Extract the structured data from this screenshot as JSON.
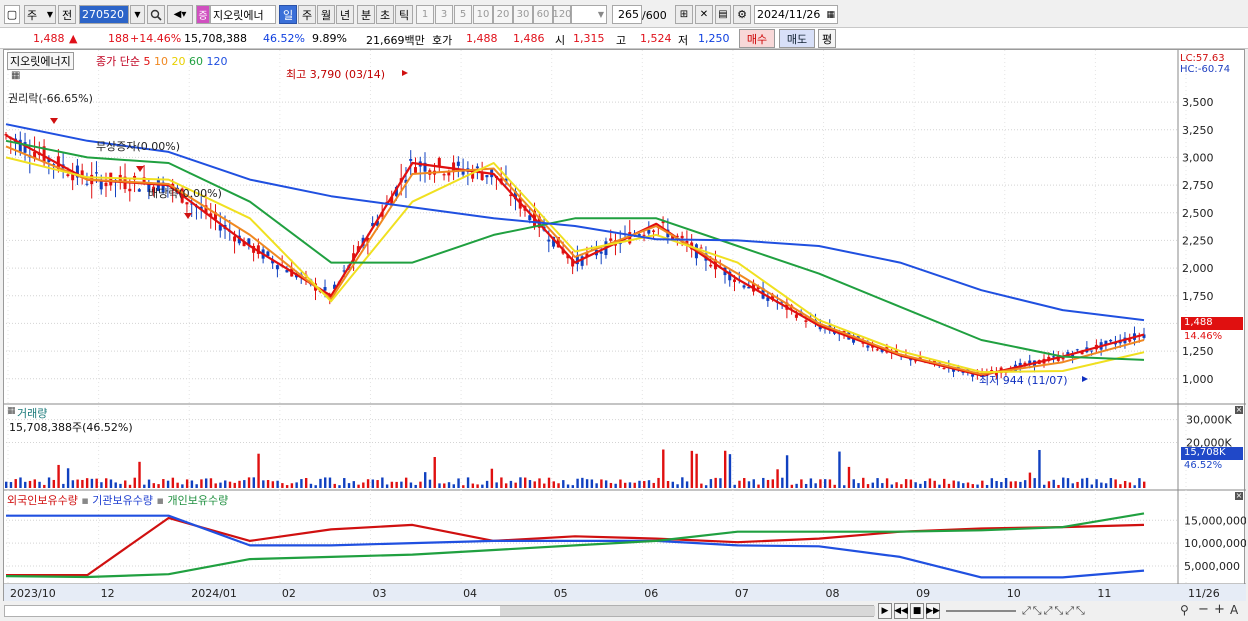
{
  "toolbar": {
    "period_type": "주",
    "prev_label": "전",
    "stock_code": "270520",
    "stock_badge": "증",
    "stock_name": "지오릿에너",
    "tabs": [
      "일",
      "주",
      "월",
      "년",
      "분",
      "초",
      "틱"
    ],
    "active_tab": "일",
    "intervals": [
      "1",
      "3",
      "5",
      "10",
      "20",
      "30",
      "60",
      "120"
    ],
    "count_value": "265",
    "count_total": "/600",
    "date": "2024/11/26"
  },
  "quote": {
    "price": "1,488",
    "change": "188",
    "change_pct": "+14.46%",
    "volume": "15,708,388",
    "vol_pct": "46.52%",
    "turnover_pct": "9.89%",
    "amount": "21,669백만",
    "hoga_label": "호가",
    "hoga_ask": "1,488",
    "hoga_bid": "1,486",
    "open_label": "시",
    "open": "1,315",
    "high_label": "고",
    "high": "1,524",
    "low_label": "저",
    "low": "1,250",
    "buy_label": "매수",
    "sell_label": "매도",
    "avg_label": "평"
  },
  "price_panel": {
    "name_box": "지오릿에너지",
    "ma_title": "종가 단순",
    "ma_periods": [
      "5",
      "10",
      "20",
      "60",
      "120"
    ],
    "lc_label": "LC:57.63",
    "hc_label": "HC:-60.74",
    "high_annotation": "최고 3,790 (03/14)",
    "low_annotation": "최저 944 (11/07)",
    "event_labels": [
      "권리락(-66.65%)",
      "무상증자(0.00%)",
      "배당락(0.00%)"
    ],
    "current_price": "1,488",
    "current_change": "14.46%"
  },
  "volume_panel": {
    "title": "거래량",
    "summary": "15,708,388주(46.52%)",
    "current_label": "15,708K",
    "current_pct": "46.52%"
  },
  "holding_panel": {
    "legend": [
      "외국인보유수량",
      "기관보유수량",
      "개인보유수량"
    ]
  },
  "x_axis_labels": [
    "2023/10",
    "12",
    "2024/01",
    "02",
    "03",
    "04",
    "05",
    "06",
    "07",
    "08",
    "09",
    "10",
    "11",
    "11/26"
  ],
  "colors": {
    "ma5": "#e01010",
    "ma10": "#f08820",
    "ma20": "#f0e020",
    "ma60": "#20a040",
    "ma120": "#2050e0",
    "up": "#e01010",
    "down": "#1040c0"
  },
  "chart_data": [
    {
      "type": "line",
      "name": "price-candles",
      "y_axis_ticks": [
        1000,
        1250,
        1500,
        1750,
        2000,
        2250,
        2500,
        2750,
        3000,
        3250,
        3500
      ],
      "y_axis_labels": [
        "1,000",
        "1,250",
        "1,500",
        "1,750",
        "2,000",
        "2,250",
        "2,500",
        "2,750",
        "3,000",
        "3,250",
        "3,500"
      ],
      "ylim": [
        790,
        3790
      ],
      "x": [
        "2023/10",
        "2023/11",
        "2023/12",
        "2024/01",
        "2024/02",
        "2024/03",
        "2024/04",
        "2024/05",
        "2024/06",
        "2024/07",
        "2024/08",
        "2024/09",
        "2024/10",
        "2024/11",
        "11/26"
      ],
      "series": [
        {
          "name": "5",
          "values": [
            3200,
            2800,
            2750,
            2200,
            1750,
            2950,
            2850,
            2050,
            2400,
            1900,
            1480,
            1210,
            1030,
            1200,
            1400
          ]
        },
        {
          "name": "10",
          "values": [
            3100,
            2800,
            2760,
            2300,
            1720,
            2850,
            2900,
            2100,
            2380,
            1950,
            1500,
            1220,
            1040,
            1150,
            1350
          ]
        },
        {
          "name": "20",
          "values": [
            3000,
            2820,
            2800,
            2450,
            1700,
            2600,
            2950,
            2150,
            2300,
            2050,
            1530,
            1250,
            1060,
            1070,
            1240
          ]
        },
        {
          "name": "60",
          "values": [
            3150,
            3000,
            2950,
            2600,
            2050,
            2050,
            2300,
            2450,
            2450,
            2200,
            1950,
            1650,
            1350,
            1200,
            1170
          ]
        },
        {
          "name": "120",
          "values": [
            3300,
            3150,
            3050,
            2800,
            2650,
            2550,
            2450,
            2380,
            2260,
            2250,
            2200,
            2050,
            1800,
            1620,
            1530
          ]
        }
      ]
    },
    {
      "type": "bar",
      "name": "volume",
      "y_axis_labels": [
        "30,000K",
        "20,000K"
      ],
      "y_axis_ticks": [
        30000,
        20000
      ],
      "ylim": [
        0,
        36000
      ],
      "unit": "K"
    },
    {
      "type": "line",
      "name": "holdings",
      "y_axis_labels": [
        "15,000,000",
        "10,000,000",
        "5,000,000"
      ],
      "y_axis_ticks": [
        15000000,
        10000000,
        5000000
      ],
      "ylim": [
        1500000,
        19000000
      ],
      "x": [
        "2023/10",
        "2023/12a",
        "2023/12b",
        "2024/01",
        "2024/02",
        "2024/03",
        "2024/04",
        "2024/05",
        "2024/06",
        "2024/07",
        "2024/08",
        "2024/09",
        "2024/10",
        "2024/11",
        "11/26"
      ],
      "series": [
        {
          "name": "외국인보유수량",
          "values": [
            3000000,
            3000000,
            15500000,
            10500000,
            13000000,
            14000000,
            10500000,
            11500000,
            11000000,
            10200000,
            11000000,
            12500000,
            13200000,
            13500000,
            14000000
          ]
        },
        {
          "name": "기관보유수량",
          "values": [
            16000000,
            16000000,
            16000000,
            9500000,
            9500000,
            10000000,
            10500000,
            10500000,
            10500000,
            9500000,
            9300000,
            7000000,
            2500000,
            2500000,
            4000000
          ]
        },
        {
          "name": "개인보유수량",
          "values": [
            2800000,
            2600000,
            3200000,
            6500000,
            7000000,
            7500000,
            8500000,
            9500000,
            10500000,
            12500000,
            12500000,
            12500000,
            12800000,
            13500000,
            16500000
          ]
        }
      ]
    }
  ]
}
